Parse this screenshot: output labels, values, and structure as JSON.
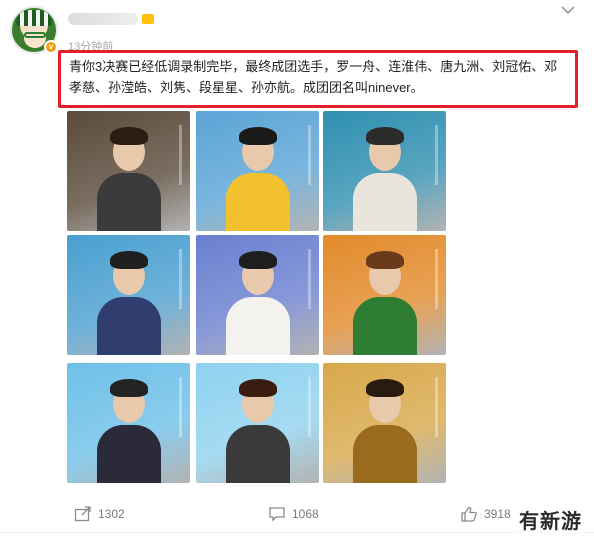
{
  "post": {
    "time": "13分钟前",
    "text": "青你3决赛已经低调录制完毕，最终成团选手，罗一舟、连淮伟、唐九洲、刘冠佑、邓孝慈、孙滢皓、刘隽、段星星、孙亦航。成团团名叫ninever。"
  },
  "photos": [
    {
      "bg": "#5a4a3a",
      "hair": "#2a1d14",
      "body": "#3b3b3b"
    },
    {
      "bg": "#5aa4d6",
      "hair": "#1a1a1a",
      "body": "#f2c12e"
    },
    {
      "bg": "#2f8fb0",
      "hair": "#2b2b2b",
      "body": "#e9e4dc"
    },
    {
      "bg": "#4a9fd0",
      "hair": "#1f1f1f",
      "body": "#2f3e6e"
    },
    {
      "bg": "#6a7fd0",
      "hair": "#1e1e1e",
      "body": "#f4f2ee"
    },
    {
      "bg": "#e28a2a",
      "hair": "#6b3a1c",
      "body": "#2e7d32"
    },
    {
      "bg": "#6ec0e8",
      "hair": "#232323",
      "body": "#2a2a3a"
    },
    {
      "bg": "#8fd2ef",
      "hair": "#3a1d10",
      "body": "#3a3a3a"
    },
    {
      "bg": "#d8a84a",
      "hair": "#2a1a10",
      "body": "#9a6a1e"
    }
  ],
  "actions": {
    "repost_count": "1302",
    "comment_count": "1068",
    "like_count": "3918"
  },
  "watermark": "有新游"
}
